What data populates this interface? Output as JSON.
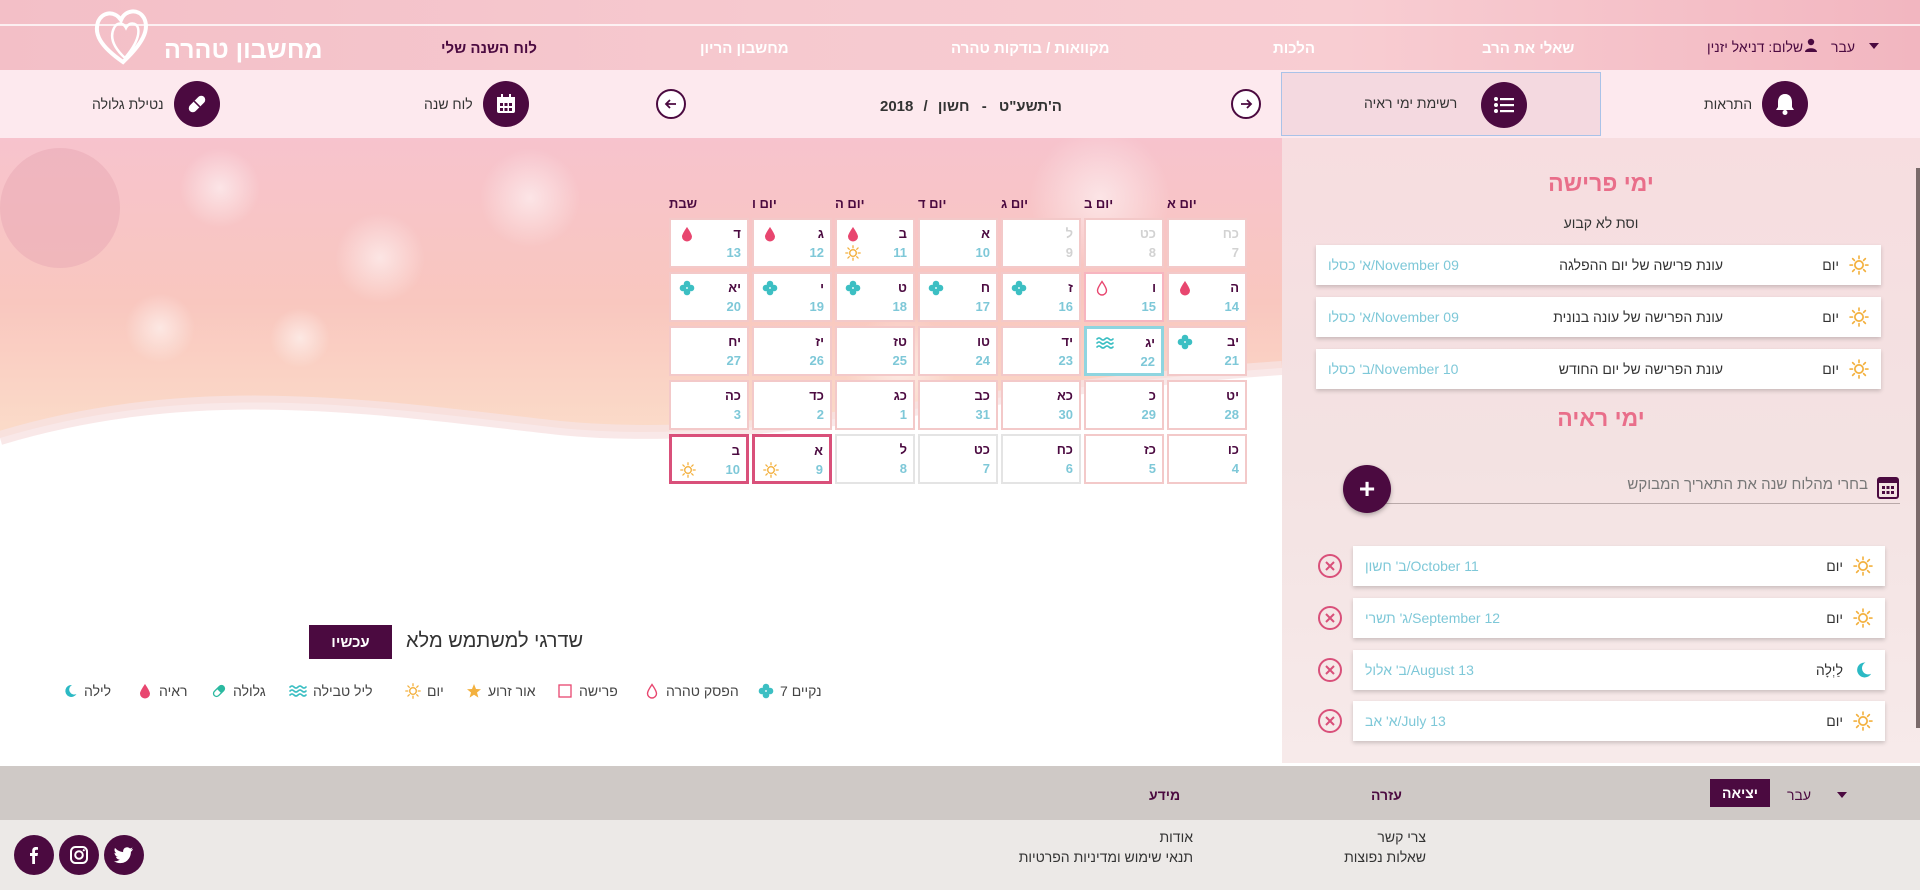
{
  "header": {
    "logo_text": "מחשבון טהרה",
    "lang_label": "עבר",
    "greeting": "שלום: דניאל יזנין",
    "nav": [
      "לוח השנה שלי",
      "מחשבון הריון",
      "מקוואות / בודקות טהרה",
      "הלכות",
      "שאלי את הרב"
    ]
  },
  "toolbar": {
    "pill_label": "נטילת גלולה",
    "year_calendar_label": "לוח שנה",
    "month_label": "חשון",
    "hebrew_year": "ה'תשע\"ט",
    "year": "2018",
    "sep1": "-",
    "sep2": "/",
    "reiyah_list_label": "רשימת ימי ראיה",
    "alerts_label": "התראות"
  },
  "calendar": {
    "days": [
      "שבת",
      "יום ו",
      "יום ה",
      "יום ד",
      "יום ג",
      "יום ב",
      "יום א"
    ],
    "weeks": [
      [
        {
          "h": "כח",
          "g": "7",
          "faded": true
        },
        {
          "h": "כט",
          "g": "8",
          "faded": true
        },
        {
          "h": "ל",
          "g": "9",
          "faded": true
        },
        {
          "h": "א",
          "g": "10"
        },
        {
          "h": "ב",
          "g": "11",
          "icon": "drop-red",
          "icon2": "sun"
        },
        {
          "h": "ג",
          "g": "12",
          "icon": "drop-red"
        },
        {
          "h": "ד",
          "g": "13",
          "icon": "drop-red"
        }
      ],
      [
        {
          "h": "ה",
          "g": "14",
          "icon": "drop-red"
        },
        {
          "h": "ו",
          "g": "15",
          "icon": "drop-outline",
          "outline": "pink"
        },
        {
          "h": "ז",
          "g": "16",
          "icon": "clover"
        },
        {
          "h": "ח",
          "g": "17",
          "icon": "clover"
        },
        {
          "h": "ט",
          "g": "18",
          "icon": "clover"
        },
        {
          "h": "י",
          "g": "19",
          "icon": "clover"
        },
        {
          "h": "יא",
          "g": "20",
          "icon": "clover"
        }
      ],
      [
        {
          "h": "יב",
          "g": "21",
          "icon": "clover"
        },
        {
          "h": "יג",
          "g": "22",
          "icon": "waves",
          "outline": "teal"
        },
        {
          "h": "יד",
          "g": "23"
        },
        {
          "h": "טו",
          "g": "24"
        },
        {
          "h": "טז",
          "g": "25"
        },
        {
          "h": "יז",
          "g": "26"
        },
        {
          "h": "יח",
          "g": "27"
        }
      ],
      [
        {
          "h": "יט",
          "g": "28"
        },
        {
          "h": "כ",
          "g": "29"
        },
        {
          "h": "כא",
          "g": "30"
        },
        {
          "h": "כב",
          "g": "31"
        },
        {
          "h": "כג",
          "g": "1"
        },
        {
          "h": "כד",
          "g": "2"
        },
        {
          "h": "כה",
          "g": "3"
        }
      ],
      [
        {
          "h": "כו",
          "g": "4"
        },
        {
          "h": "כז",
          "g": "5"
        },
        {
          "h": "כח",
          "g": "6",
          "grey": true
        },
        {
          "h": "כט",
          "g": "7",
          "grey": true
        },
        {
          "h": "ל",
          "g": "8",
          "grey": true
        },
        {
          "h": "א",
          "g": "9",
          "icon2": "sun",
          "outline": "sel"
        },
        {
          "h": "ב",
          "g": "10",
          "icon2": "sun",
          "outline": "sel"
        }
      ]
    ]
  },
  "upgrade": {
    "text": "שדרגי למשתמש מלא",
    "button": "עכשיו"
  },
  "legend": [
    {
      "label": "7 נקיים",
      "icon": "clover"
    },
    {
      "label": "הפסק טהרה",
      "icon": "drop-outline"
    },
    {
      "label": "פרישה",
      "icon": "square"
    },
    {
      "label": "אור זרוע",
      "icon": "star"
    },
    {
      "label": "יום",
      "icon": "sun"
    },
    {
      "label": "ליל טבילה",
      "icon": "waves"
    },
    {
      "label": "גלולה",
      "icon": "pill"
    },
    {
      "label": "ראיה",
      "icon": "drop-red"
    },
    {
      "label": "לילה",
      "icon": "moon"
    }
  ],
  "right": {
    "prisha_title": "ימי פרישה",
    "prisha_subtitle": "וסת לא קבוע",
    "prisha_rows": [
      {
        "time": "יום",
        "desc": "עונת פרישה של יום ההפלגה",
        "date": "א' כסלו/November 09"
      },
      {
        "time": "יום",
        "desc": "עונת הפרישה של עונה בנונית",
        "date": "א' כסלו/November 09"
      },
      {
        "time": "יום",
        "desc": "עונת הפרישה של יום החודש",
        "date": "ב' כסלו/November 10"
      }
    ],
    "reiyah_title": "ימי ראיה",
    "picker_placeholder": "בחרי מהלוח שנה את התאריך המבוקש",
    "add_label": "+",
    "reiyah_rows": [
      {
        "time": "יום",
        "icon": "sun",
        "date": "ב' חשון/October 11"
      },
      {
        "time": "יום",
        "icon": "sun",
        "date": "ג' תשרי/September 12"
      },
      {
        "time": "לַיְלָה",
        "icon": "moon",
        "date": "ב' אלול/August 13"
      },
      {
        "time": "יום",
        "icon": "sun",
        "date": "א' אב/July 13"
      }
    ]
  },
  "footer": {
    "lang_label": "עבר",
    "logout": "יציאה",
    "col_help": "עזרה",
    "col_info": "מידע",
    "contact": "צרי קשר",
    "faq": "שאלות נפוצות",
    "about": "אודות",
    "terms": "תנאי שימוש ומדיניות הפרטיות"
  },
  "colors": {
    "brand": "#4b0a40",
    "accent": "#e96e8a",
    "teal": "#7ec8d8",
    "red": "#e8466f"
  }
}
